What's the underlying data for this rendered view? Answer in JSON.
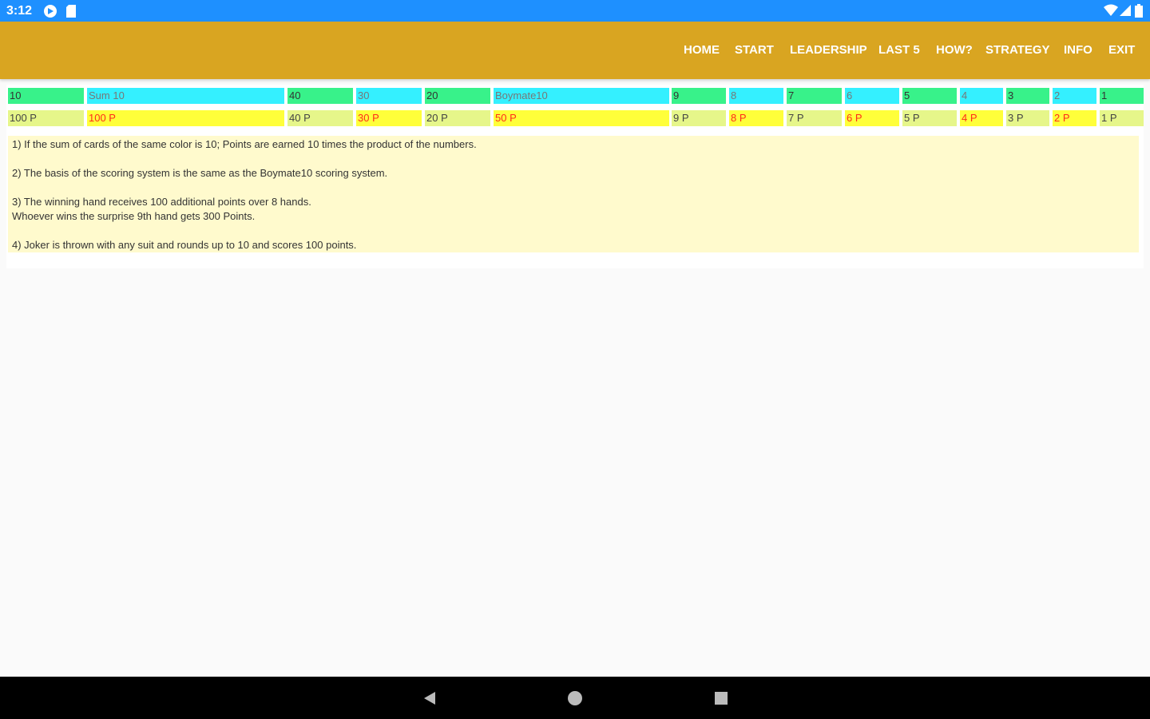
{
  "status_bar": {
    "time": "3:12",
    "icons_left": [
      "play-protect-icon",
      "sd-card-icon"
    ],
    "icons_right": [
      "wifi-icon",
      "cell-signal-icon",
      "battery-icon"
    ]
  },
  "app_bar": {
    "nav": [
      "HOME",
      "START",
      "LEADERSHIP",
      "LAST 5",
      "HOW?",
      "STRATEGY",
      "INFO",
      "EXIT"
    ]
  },
  "score_table": {
    "top_row": [
      "10",
      "Sum 10",
      "40",
      "30",
      "20",
      "Boymate10",
      "9",
      "8",
      "7",
      "6",
      "5",
      "4",
      "3",
      "2",
      "1"
    ],
    "bottom_row": [
      "100 P",
      "100 P",
      "40 P",
      "30 P",
      "20 P",
      "50 P",
      "9 P",
      "8 P",
      "7 P",
      "6 P",
      "5 P",
      "4 P",
      "3 P",
      "2 P",
      "1 P"
    ]
  },
  "rules": [
    "1) If the sum of cards of the same color is 10; Points are earned 10 times the product of the numbers.",
    "2) The basis of the scoring system is the same as the Boymate10 scoring system.",
    "3) The winning hand receives 100 additional points over 8 hands.",
    "Whoever wins the surprise 9th hand gets 300 Points.",
    "4) Joker is thrown with any suit and rounds up to 10 and scores 100 points."
  ],
  "colors": {
    "status_bar": "#1e90ff",
    "app_bar": "#d9a521",
    "green_cell": "#38f28a",
    "cyan_cell": "#34f0ff",
    "lime_cell": "#e6f68a",
    "yellow_cell": "#ffff3a",
    "rules_bg": "#fffacd"
  },
  "system_nav": [
    "back-icon",
    "home-icon",
    "recents-icon"
  ]
}
